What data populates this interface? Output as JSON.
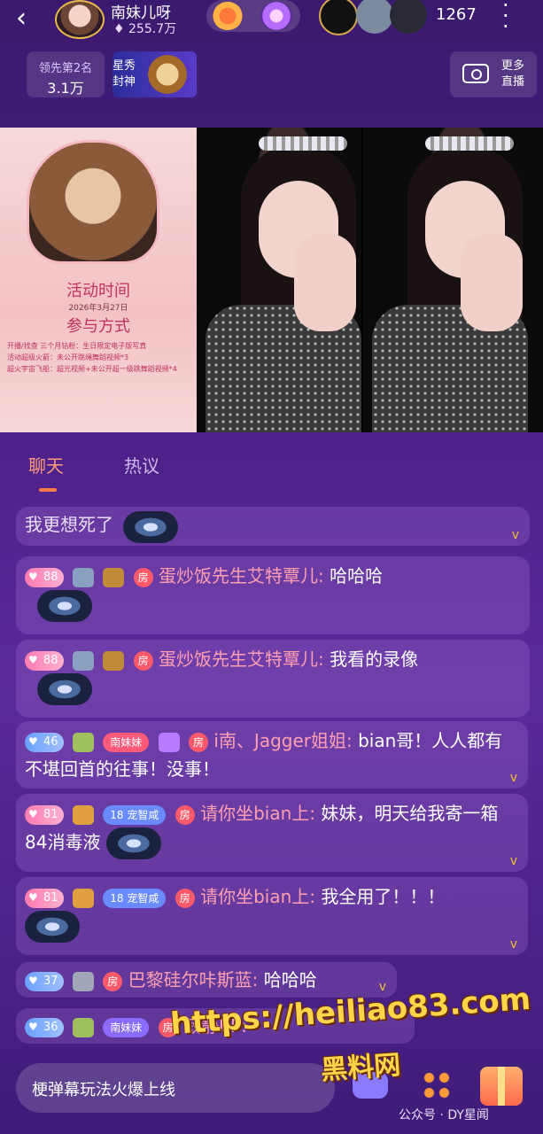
{
  "header": {
    "host_name": "南妹儿呀",
    "host_fans": "255.7万",
    "viewer_count": "1267",
    "back_icon": "chevron-left-icon",
    "more_icon": "more-vertical-icon"
  },
  "rank": {
    "label": "领先第2名",
    "value": "3.1万"
  },
  "star_banner": {
    "text": "星秀\n封神"
  },
  "more_live": {
    "label": "更多\n直播"
  },
  "poster": {
    "title1": "活动时间",
    "date": "2026年3月27日",
    "title2": "参与方式",
    "line1": "开播/找查 三个月钻粉：生日限定电子版写真",
    "line2": "活动超级火箭：未公开跳绳舞蹈视频*3",
    "line3": "超火宇宙飞船：超光视频+未公开超一级跳舞蹈视频*4"
  },
  "tabs": {
    "chat": "聊天",
    "hot": "热议"
  },
  "chat": [
    {
      "text": "我更想死了"
    },
    {
      "level": "88",
      "name": "蛋炒饭先生艾特覃儿:",
      "content": "哈哈哈"
    },
    {
      "level": "88",
      "name": "蛋炒饭先生艾特覃儿:",
      "content": "我看的录像"
    },
    {
      "level": "46",
      "fanclub": "南妹妹",
      "name": "i南、Jagger姐姐:",
      "content": "bian哥！人人都有不堪回首的往事！没事！"
    },
    {
      "level": "81",
      "fanlevel": "18",
      "fanclub": "宠智咸",
      "name": "请你坐bian上:",
      "content": "妹妹，明天给我寄一箱84消毒液"
    },
    {
      "level": "81",
      "fanlevel": "18",
      "fanclub": "宠智咸",
      "name": "请你坐bian上:",
      "content": "我全用了！！！"
    },
    {
      "level": "37",
      "name": "巴黎硅尔咔斯蓝:",
      "content": "哈哈哈"
    },
    {
      "level": "36",
      "fanclub": "南妹妹",
      "name": "寂静KP:"
    }
  ],
  "room_badge": "房",
  "input": {
    "placeholder": "梗弹幕玩法火爆上线"
  },
  "watermark": {
    "url": "https://heiliao83.com",
    "cn": "黑料网",
    "credit": "公众号 · DY星闻"
  },
  "colors": {
    "accent": "#ff7a4a",
    "name_color": "#ff9fb0",
    "background": "#4a1f86"
  }
}
